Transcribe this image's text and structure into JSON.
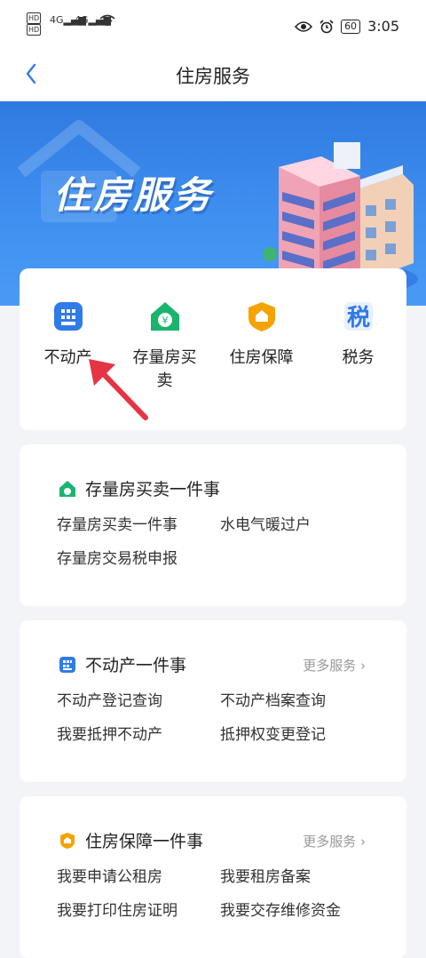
{
  "status": {
    "left_badges": [
      "HD",
      "HD"
    ],
    "signal1": "4G",
    "signal2": "4G",
    "battery": "60",
    "time": "3:05"
  },
  "nav": {
    "title": "住房服务"
  },
  "banner": {
    "title": "住房服务"
  },
  "services": [
    {
      "label": "不动产",
      "icon": "building-grid-icon",
      "color": "#2f7be8"
    },
    {
      "label": "存量房买卖",
      "icon": "house-yen-icon",
      "color": "#19b46e"
    },
    {
      "label": "住房保障",
      "icon": "shield-house-icon",
      "color": "#f4a300"
    },
    {
      "label": "税务",
      "icon": "tax-character-icon",
      "color": "#2f7be8"
    }
  ],
  "sections": [
    {
      "title": "存量房买卖一件事",
      "more": "",
      "items": [
        "存量房买卖一件事",
        "水电气暖过户",
        "存量房交易税申报",
        ""
      ]
    },
    {
      "title": "不动产一件事",
      "more": "更多服务",
      "items": [
        "不动产登记查询",
        "不动产档案查询",
        "我要抵押不动产",
        "抵押权变更登记"
      ]
    },
    {
      "title": "住房保障一件事",
      "more": "更多服务",
      "items": [
        "我要申请公租房",
        "我要租房备案",
        "我要打印住房证明",
        "我要交存维修资金"
      ]
    }
  ]
}
